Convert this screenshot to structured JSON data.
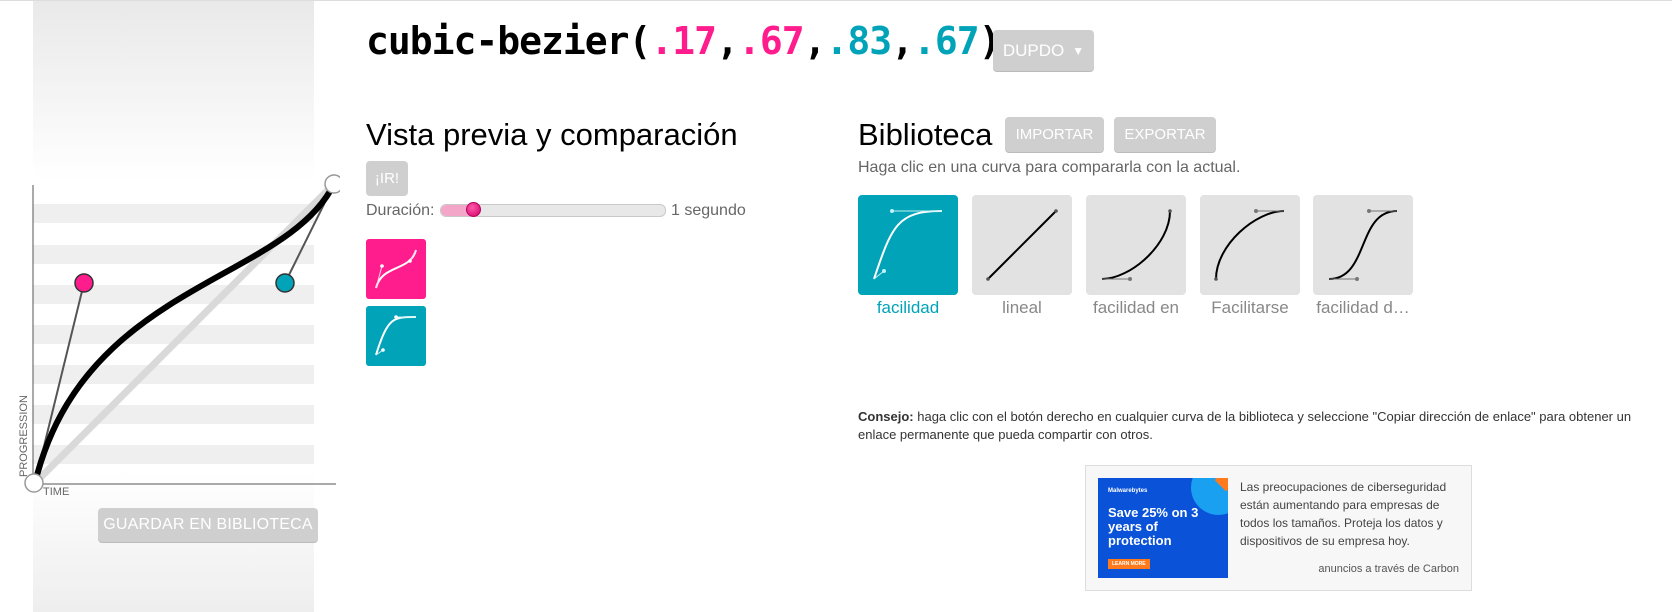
{
  "formula": {
    "prefix": "cubic-bezier(",
    "p1x": ".17",
    "comma1": ",",
    "p1y": ".67",
    "comma2": ",",
    "p2x": ".83",
    "comma3": ",",
    "p2y": ".67",
    "suffix": ")"
  },
  "mode_button": {
    "label": "DUPDO",
    "caret": "▼"
  },
  "editor": {
    "axis_y_label": "PROGRESSION",
    "axis_x_label": "TIME",
    "save_label": "GUARDAR EN BIBLIOTECA"
  },
  "preview": {
    "title": "Vista previa y comparación",
    "go_label": "¡IR!",
    "duration_label": "Duración:",
    "duration_value": "1 segundo",
    "duration_slider_fraction": 0.12
  },
  "library": {
    "title": "Biblioteca",
    "import_label": "IMPORTAR",
    "export_label": "EXPORTAR",
    "description": "Haga clic en una curva para compararla con la actual.",
    "items": [
      {
        "label": "facilidad",
        "active": true
      },
      {
        "label": "lineal",
        "active": false
      },
      {
        "label": "facilidad en",
        "active": false
      },
      {
        "label": "Facilitarse",
        "active": false
      },
      {
        "label": "facilidad d…",
        "active": false
      }
    ]
  },
  "tip": {
    "lead": "Consejo:",
    "text": " haga clic con el botón derecho en cualquier curva de la biblioteca y seleccione \"Copiar dirección de enlace\" para obtener un enlace permanente que pueda compartir con otros."
  },
  "ad": {
    "brand": "Malwarebytes",
    "headline": "Save 25% on 3 years of protection",
    "cta": "LEARN MORE",
    "text": "Las preocupaciones de ciberseguridad están aumentando para empresas de todos los tamaños. Proteja los datos y dispositivos de su empresa hoy.",
    "via": "anuncios a través de Carbon"
  },
  "colors": {
    "pink": "#ff1d8e",
    "teal": "#00a3b7",
    "button_gray": "#cfcfcf"
  }
}
